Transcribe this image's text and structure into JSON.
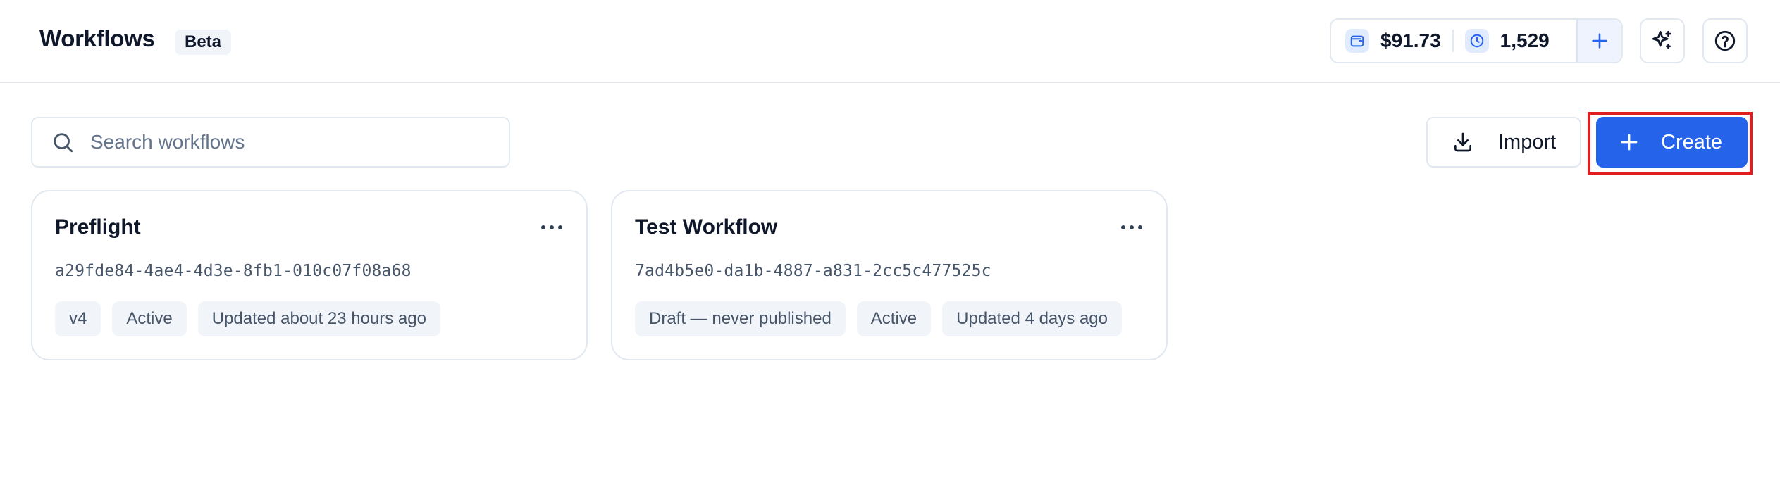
{
  "header": {
    "title": "Workflows",
    "badge": "Beta",
    "balance": {
      "wallet_icon": "wallet-icon",
      "amount": "$91.73",
      "credits_icon": "clock-icon",
      "credits": "1,529",
      "add_icon": "plus-icon"
    },
    "assistant_icon": "sparkles-icon",
    "help_icon": "help-circle-icon"
  },
  "toolbar": {
    "search_placeholder": "Search workflows",
    "search_value": "",
    "import_label": "Import",
    "create_label": "Create"
  },
  "workflows": [
    {
      "title": "Preflight",
      "id": "a29fde84-4ae4-4d3e-8fb1-010c07f08a68",
      "chips": [
        "v4",
        "Active",
        "Updated about 23 hours ago"
      ]
    },
    {
      "title": "Test Workflow",
      "id": "7ad4b5e0-da1b-4887-a831-2cc5c477525c",
      "chips": [
        "Draft — never published",
        "Active",
        "Updated 4 days ago"
      ]
    }
  ],
  "colors": {
    "accent": "#2563eb",
    "highlight": "#e11d1d",
    "border": "#e2e8f0",
    "chip_bg": "#f1f5f9"
  }
}
